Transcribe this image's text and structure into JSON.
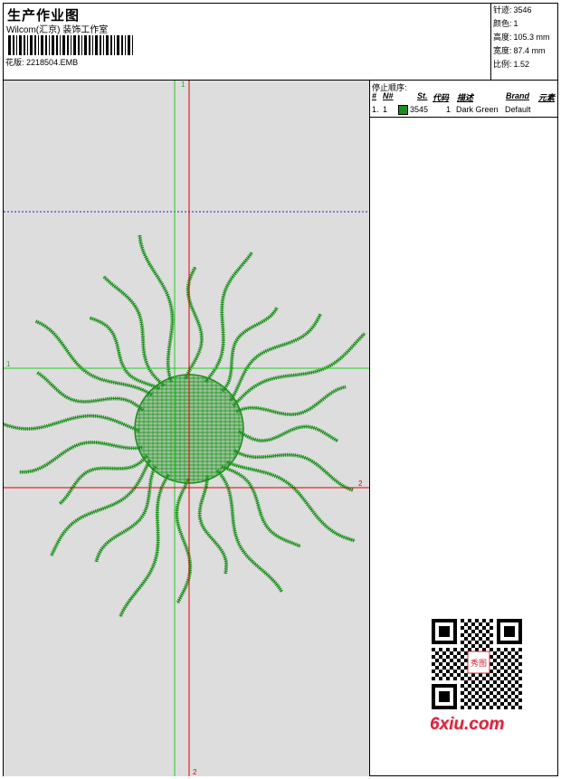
{
  "header": {
    "title": "生产作业图",
    "company": "Wilcom(汇京) 装饰工作室",
    "design_label": "花版:",
    "design_file": "2218504.EMB"
  },
  "stats": [
    {
      "label": "针迹:",
      "value": "3546"
    },
    {
      "label": "颜色:",
      "value": "1"
    },
    {
      "label": "高度:",
      "value": "105.3 mm"
    },
    {
      "label": "宽度:",
      "value": "87.4 mm"
    },
    {
      "label": "比例:",
      "value": "1.52"
    }
  ],
  "stop_sequence": {
    "title": "停止顺序:",
    "columns": [
      "#",
      "N#",
      "St.",
      "代码",
      "描述",
      "Brand",
      "元素"
    ],
    "rows": [
      {
        "index": "1.",
        "n": "1",
        "stitches": "3545",
        "code": "1",
        "description": "Dark Green",
        "brand": "Default",
        "color": "#1a8f1a"
      }
    ]
  },
  "guides": {
    "vertical_label_top": "1",
    "vertical_label_bottom": "2",
    "horizontal_label_left": "1",
    "horizontal_label_right": "2"
  },
  "watermark": {
    "site": "6xiu.com",
    "qr_text": "秀图"
  },
  "colors": {
    "thread": "#1a8f1a",
    "guide_red": "#e00000",
    "guide_green": "#22cc22",
    "guide_blue": "#2222cc",
    "canvas_bg": "#dddddd"
  }
}
